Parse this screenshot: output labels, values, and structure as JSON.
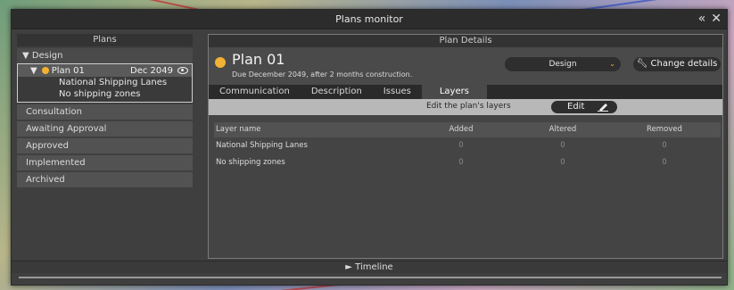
{
  "window": {
    "title": "Plans monitor",
    "collapse_glyph": "«",
    "close_glyph": "✕"
  },
  "plans_panel": {
    "header": "Plans",
    "expanded_category": "Design",
    "expanded_arrow": "▼",
    "plan": {
      "arrow": "▼",
      "name": "Plan 01",
      "date": "Dec 2049",
      "status_color": "#f2b132"
    },
    "layers": [
      "National Shipping Lanes",
      "No shipping zones"
    ],
    "other_categories": [
      "Consultation",
      "Awaiting Approval",
      "Approved",
      "Implemented",
      "Archived"
    ]
  },
  "details_panel": {
    "header": "Plan Details",
    "plan_title": "Plan 01",
    "due_text": "Due December 2049, after 2 months construction.",
    "status_value": "Design",
    "status_chevron": "⌄",
    "change_details_label": "Change details",
    "tabs": [
      "Communication",
      "Description",
      "Issues",
      "Layers"
    ],
    "active_tab": "Layers",
    "layers_bar_label": "Edit the plan's layers",
    "edit_label": "Edit",
    "table": {
      "columns": [
        "Layer name",
        "Added",
        "Altered",
        "Removed"
      ],
      "rows": [
        {
          "name": "National Shipping Lanes",
          "added": "0",
          "altered": "0",
          "removed": "0"
        },
        {
          "name": "No shipping zones",
          "added": "0",
          "altered": "0",
          "removed": "0"
        }
      ]
    }
  },
  "timeline": {
    "label": "► Timeline"
  },
  "colors": {
    "accent": "#f2b132",
    "panel": "#3f3f3f",
    "bar": "#b8b8b8"
  }
}
